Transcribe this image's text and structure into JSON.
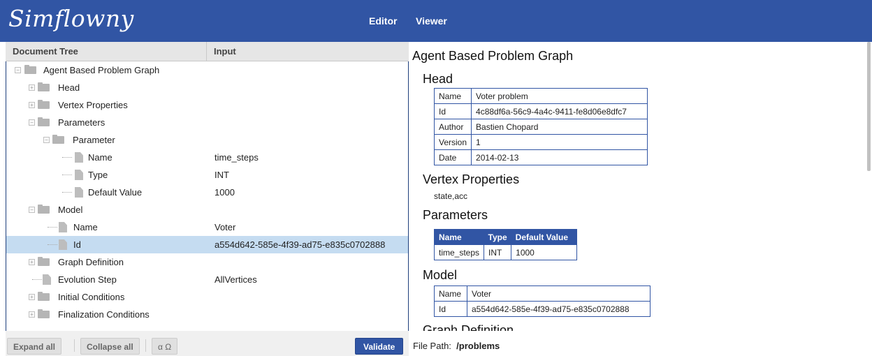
{
  "app": {
    "logo": "Simflowny"
  },
  "nav": {
    "editor": "Editor",
    "viewer": "Viewer"
  },
  "left": {
    "header_tree": "Document Tree",
    "header_input": "Input"
  },
  "tree": [
    {
      "label": "Agent Based Problem Graph",
      "value": "",
      "depth": 0,
      "type": "folder",
      "open": true
    },
    {
      "label": "Head",
      "value": "",
      "depth": 1,
      "type": "folder",
      "open": false
    },
    {
      "label": "Vertex Properties",
      "value": "",
      "depth": 1,
      "type": "folder",
      "open": false
    },
    {
      "label": "Parameters",
      "value": "",
      "depth": 1,
      "type": "folder",
      "open": true
    },
    {
      "label": "Parameter",
      "value": "",
      "depth": 2,
      "type": "folder",
      "open": true
    },
    {
      "label": "Name",
      "value": "time_steps",
      "depth": 3,
      "type": "file"
    },
    {
      "label": "Type",
      "value": "INT",
      "depth": 3,
      "type": "file"
    },
    {
      "label": "Default Value",
      "value": "1000",
      "depth": 3,
      "type": "file"
    },
    {
      "label": "Model",
      "value": "",
      "depth": 1,
      "type": "folder",
      "open": true
    },
    {
      "label": "Name",
      "value": "Voter",
      "depth": 2,
      "type": "file"
    },
    {
      "label": "Id",
      "value": "a554d642-585e-4f39-ad75-e835c0702888",
      "depth": 2,
      "type": "file",
      "selected": true
    },
    {
      "label": "Graph Definition",
      "value": "",
      "depth": 1,
      "type": "folder",
      "open": false
    },
    {
      "label": "Evolution Step",
      "value": "AllVertices",
      "depth": 1,
      "type": "file"
    },
    {
      "label": "Initial Conditions",
      "value": "",
      "depth": 1,
      "type": "folder",
      "open": false
    },
    {
      "label": "Finalization Conditions",
      "value": "",
      "depth": 1,
      "type": "folder",
      "open": false
    }
  ],
  "buttons": {
    "expand_all": "Expand all",
    "collapse_all": "Collapse all",
    "symbols": "α Ω",
    "validate": "Validate"
  },
  "viewer": {
    "title": "Agent Based Problem Graph",
    "head_title": "Head",
    "head_rows": [
      {
        "k": "Name",
        "v": "Voter problem"
      },
      {
        "k": "Id",
        "v": "4c88df6a-56c9-4a4c-9411-fe8d06e8dfc7"
      },
      {
        "k": "Author",
        "v": "Bastien Chopard"
      },
      {
        "k": "Version",
        "v": "1"
      },
      {
        "k": "Date",
        "v": "2014-02-13"
      }
    ],
    "vertex_title": "Vertex Properties",
    "vertex_value": "state,acc",
    "params_title": "Parameters",
    "params_headers": [
      "Name",
      "Type",
      "Default Value"
    ],
    "params_row": [
      "time_steps",
      "INT",
      "1000"
    ],
    "model_title": "Model",
    "model_rows": [
      {
        "k": "Name",
        "v": "Voter"
      },
      {
        "k": "Id",
        "v": "a554d642-585e-4f39-ad75-e835c0702888"
      }
    ],
    "graph_title": "Graph Definition"
  },
  "filepath": {
    "label": "File Path:",
    "value": "/problems"
  },
  "colors": {
    "brand": "#3155a4",
    "selection": "#c5dcf1"
  }
}
